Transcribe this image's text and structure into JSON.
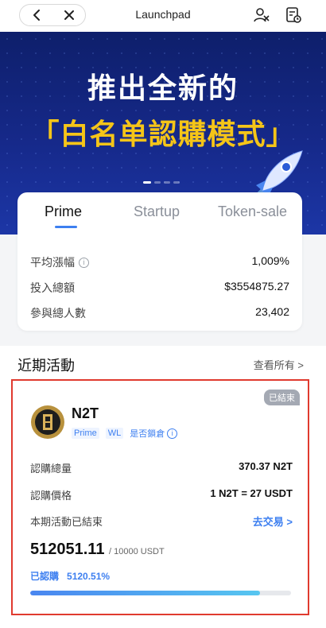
{
  "header": {
    "title": "Launchpad",
    "back_icon": "chevron-left-icon",
    "close_icon": "close-icon",
    "right_icons": [
      "user-switch-icon",
      "order-history-icon"
    ]
  },
  "banner": {
    "line1": "推出全新的",
    "line2": "「白名单認購模式」",
    "pager_count": 4,
    "pager_active": 0
  },
  "tabs": [
    {
      "label": "Prime",
      "active": true
    },
    {
      "label": "Startup",
      "active": false
    },
    {
      "label": "Token-sale",
      "active": false
    }
  ],
  "summary": {
    "stats": [
      {
        "label": "平均漲幅",
        "value": "1,009%",
        "has_info": true
      },
      {
        "label": "投入總額",
        "value": "$3554875.27"
      },
      {
        "label": "參與總人數",
        "value": "23,402"
      }
    ]
  },
  "recent": {
    "title": "近期活動",
    "view_all": "查看所有 >"
  },
  "card": {
    "status_badge": "已結束",
    "coin_name": "N2T",
    "chips": [
      "Prime",
      "WL"
    ],
    "lock_label": "是否鎖倉",
    "rows": [
      {
        "label": "認購總量",
        "value": "370.37 N2T"
      },
      {
        "label": "認購價格",
        "value": "1 N2T = 27 USDT"
      },
      {
        "label": "本期活動已結束",
        "value": "去交易 >"
      }
    ],
    "amount": "512051.11",
    "amount_target": "/ 10000 USDT",
    "subscribed_label": "已認購",
    "subscribed_percent": "5120.51%",
    "progress_fraction": 0.88
  },
  "colors": {
    "accent": "#3d7ff0",
    "banner_bg": "#16298a",
    "banner_highlight": "#f5c518",
    "card_border": "#e03a2f"
  }
}
